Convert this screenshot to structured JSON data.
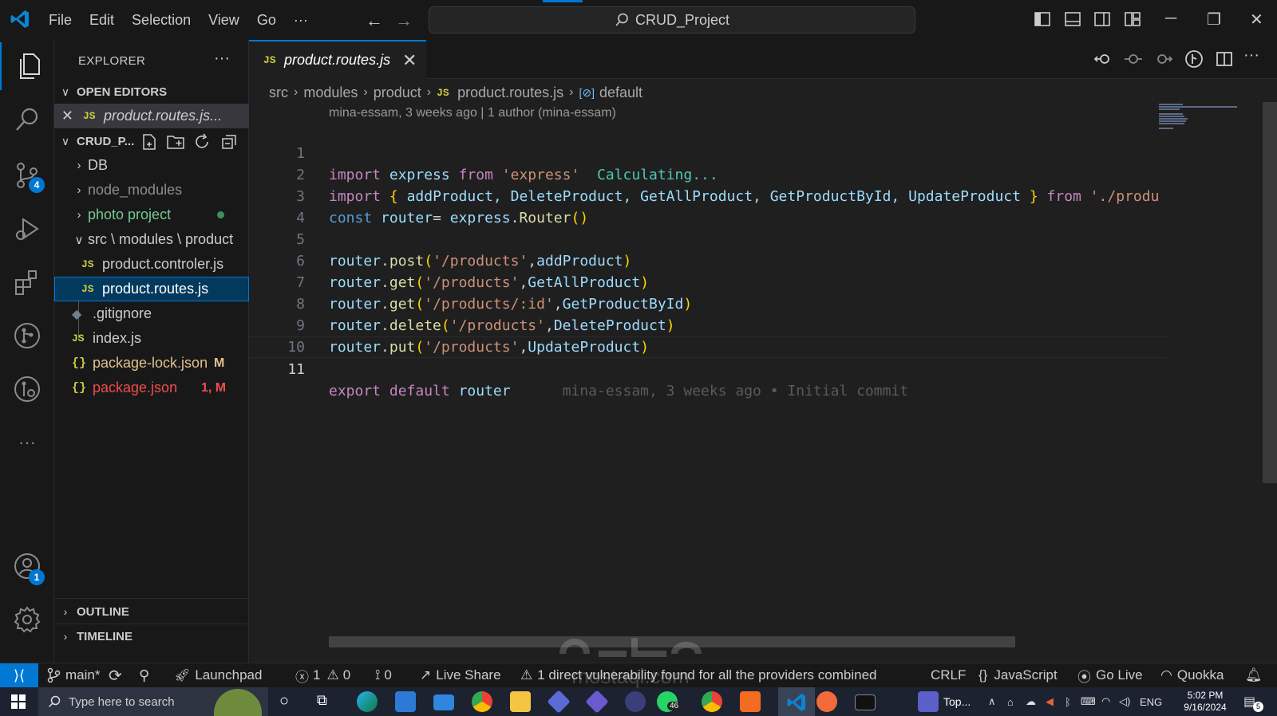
{
  "titlebar": {
    "menu": [
      "File",
      "Edit",
      "Selection",
      "View",
      "Go",
      "···"
    ],
    "search": "CRUD_Project"
  },
  "activity_bar": {
    "source_control_badge": "4",
    "accounts_badge": "1",
    "more": "···"
  },
  "sidebar": {
    "title": "EXPLORER",
    "more": "···",
    "open_editors_label": "OPEN EDITORS",
    "open_editor_file": "product.routes.js...",
    "project_label": "CRUD_P...",
    "tree": [
      {
        "label": "DB"
      },
      {
        "label": "node_modules"
      },
      {
        "label": "photo project"
      },
      {
        "label": "src \\ modules \\ product"
      },
      {
        "label": "product.controler.js"
      },
      {
        "label": "product.routes.js"
      },
      {
        "label": ".gitignore"
      },
      {
        "label": "index.js"
      },
      {
        "label": "package-lock.json",
        "status": "M"
      },
      {
        "label": "package.json",
        "status": "1, M"
      }
    ],
    "outline_label": "OUTLINE",
    "timeline_label": "TIMELINE"
  },
  "editor": {
    "tab_label": "product.routes.js",
    "breadcrumb": [
      "src",
      "modules",
      "product",
      "product.routes.js",
      "default"
    ],
    "codelens": "mina-essam, 3 weeks ago | 1 author (mina-essam)",
    "line_numbers": [
      "1",
      "2",
      "3",
      "4",
      "5",
      "6",
      "7",
      "8",
      "9",
      "10",
      "11"
    ],
    "line1": {
      "kw1": "import",
      "name": "express",
      "kw2": "from",
      "str": "'express'",
      "ghost": "Calculating..."
    },
    "line2": {
      "kw1": "import",
      "lb": "{",
      "items": "addProduct, DeleteProduct, GetAllProduct, GetProductById, UpdateProduct",
      "rb": "}",
      "kw2": "from",
      "str": "'./produ"
    },
    "line3": {
      "kw": "const",
      "var": "router",
      "op": "=",
      "obj": "express",
      "fn": "Router",
      "paren": "()"
    },
    "route_lines": [
      {
        "obj": "router",
        "method": "post",
        "path": "'/products'",
        "handler": "addProduct"
      },
      {
        "obj": "router",
        "method": "get",
        "path": "'/products'",
        "handler": "GetAllProduct"
      },
      {
        "obj": "router",
        "method": "get",
        "path": "'/products/:id'",
        "handler": "GetProductById"
      },
      {
        "obj": "router",
        "method": "delete",
        "path": "'/products'",
        "handler": "DeleteProduct"
      },
      {
        "obj": "router",
        "method": "put",
        "path": "'/products'",
        "handler": "UpdateProduct"
      }
    ],
    "line11": {
      "kw1": "export",
      "kw2": "default",
      "var": "router",
      "blame": "mina-essam, 3 weeks ago • Initial commit"
    }
  },
  "statusbar": {
    "branch": "main*",
    "launchpad": "Launchpad",
    "errors": "1",
    "warnings": "0",
    "ports": "0",
    "live_share": "Live Share",
    "vulnerability": "1 direct vulnerability found for all the providers combined",
    "eol": "CRLF",
    "language": "JavaScript",
    "go_live": "Go Live",
    "quokka": "Quokka"
  },
  "taskbar": {
    "search_placeholder": "Type here to search",
    "whatsapp_badge": "46",
    "teams_label": "Top...",
    "lang": "ENG",
    "time": "5:02 PM",
    "date": "9/16/2024",
    "notif": "5"
  },
  "watermark": {
    "text": "mostaql.com"
  },
  "colors": {
    "accent": "#0078d4",
    "keyword": "#c586c0",
    "string": "#ce9178",
    "variable": "#9cdcfe",
    "function": "#dcdcaa"
  }
}
